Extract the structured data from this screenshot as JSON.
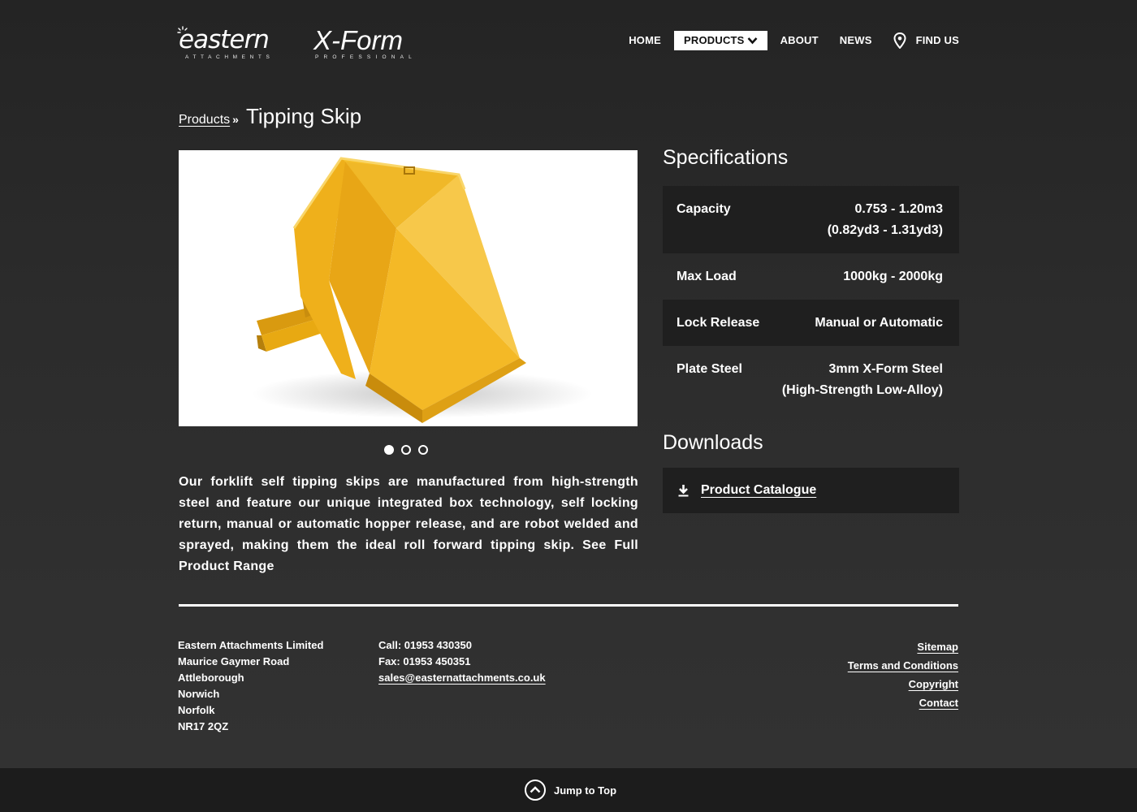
{
  "brand": {
    "logo1_main": "eastern",
    "logo1_sub": "ATTACHMENTS",
    "logo2_main": "X-Form",
    "logo2_sub": "PROFESSIONAL"
  },
  "nav": {
    "items": [
      {
        "label": "HOME"
      },
      {
        "label": "PRODUCTS",
        "active": true
      },
      {
        "label": "ABOUT"
      },
      {
        "label": "NEWS"
      },
      {
        "label": "FIND US",
        "icon": "location-pin-icon"
      }
    ]
  },
  "breadcrumb": {
    "parent": "Products",
    "separator": "»",
    "current": "Tipping Skip"
  },
  "gallery": {
    "slide_count": 3,
    "active_slide": 1
  },
  "description": "Our forklift self tipping skips are manufactured from high-strength steel and feature our unique integrated box technology, self locking return, manual or automatic hopper release, and are robot welded and sprayed, making them the ideal roll forward tipping skip. See Full Product Range",
  "specifications": {
    "title": "Specifications",
    "rows": [
      {
        "label": "Capacity",
        "value_line1": "0.753 - 1.20m3",
        "value_line2": "(0.82yd3 - 1.31yd3)"
      },
      {
        "label": "Max Load",
        "value_line1": "1000kg - 2000kg",
        "value_line2": ""
      },
      {
        "label": "Lock Release",
        "value_line1": "Manual or Automatic",
        "value_line2": ""
      },
      {
        "label": "Plate Steel",
        "value_line1": "3mm X-Form Steel",
        "value_line2": "(High-Strength Low-Alloy)"
      }
    ]
  },
  "downloads": {
    "title": "Downloads",
    "items": [
      {
        "label": "Product Catalogue",
        "icon": "download-icon"
      }
    ]
  },
  "footer": {
    "address": [
      "Eastern Attachments Limited",
      "Maurice Gaymer Road",
      "Attleborough",
      "Norwich",
      "Norfolk",
      "NR17 2QZ"
    ],
    "call": "Call: 01953 430350",
    "fax": "Fax: 01953 450351",
    "email": "sales@easternattachments.co.uk",
    "links": [
      "Sitemap",
      "Terms and Conditions",
      "Copyright",
      "Contact"
    ]
  },
  "jump_to_top": "Jump to Top",
  "colors": {
    "background": "#2a2a2a",
    "dark_row": "#1f1f1f",
    "bottom_bar": "#1c1c1c",
    "skip_yellow": "#f0b21c"
  }
}
